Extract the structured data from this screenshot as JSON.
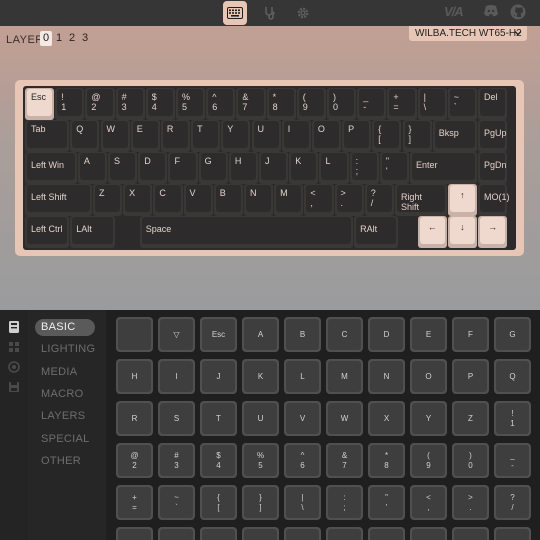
{
  "topbar": {
    "via_logo": "V/A"
  },
  "layer": {
    "label": "LAYER",
    "options": [
      "0",
      "1",
      "2",
      "3"
    ],
    "active": "0"
  },
  "device": {
    "name": "WILBA.TECH WT65-H2"
  },
  "keyboard": {
    "rows": [
      [
        {
          "l1": "Esc",
          "light": true
        },
        {
          "l1": "!",
          "l2": "1"
        },
        {
          "l1": "@",
          "l2": "2"
        },
        {
          "l1": "#",
          "l2": "3"
        },
        {
          "l1": "$",
          "l2": "4"
        },
        {
          "l1": "%",
          "l2": "5"
        },
        {
          "l1": "^",
          "l2": "6"
        },
        {
          "l1": "&",
          "l2": "7"
        },
        {
          "l1": "*",
          "l2": "8"
        },
        {
          "l1": "(",
          "l2": "9"
        },
        {
          "l1": ")",
          "l2": "0"
        },
        {
          "l1": "_",
          "l2": "-"
        },
        {
          "l1": "+",
          "l2": "="
        },
        {
          "l1": "|",
          "l2": "\\"
        },
        {
          "l1": "~",
          "l2": "`"
        },
        {
          "l1": "Del"
        }
      ],
      [
        {
          "l1": "Tab"
        },
        {
          "l1": "Q",
          "big": true
        },
        {
          "l1": "W",
          "big": true
        },
        {
          "l1": "E",
          "big": true
        },
        {
          "l1": "R",
          "big": true
        },
        {
          "l1": "T",
          "big": true
        },
        {
          "l1": "Y",
          "big": true
        },
        {
          "l1": "U",
          "big": true
        },
        {
          "l1": "I",
          "big": true
        },
        {
          "l1": "O",
          "big": true
        },
        {
          "l1": "P",
          "big": true
        },
        {
          "l1": "{",
          "l2": "["
        },
        {
          "l1": "}",
          "l2": "]"
        },
        {
          "l1": "Bksp",
          "mid": true
        },
        {
          "l1": "PgUp",
          "mid": true
        }
      ],
      [
        {
          "l1": "Left Win",
          "mid": true
        },
        {
          "l1": "A",
          "big": true
        },
        {
          "l1": "S",
          "big": true
        },
        {
          "l1": "D",
          "big": true
        },
        {
          "l1": "F",
          "big": true
        },
        {
          "l1": "G",
          "big": true
        },
        {
          "l1": "H",
          "big": true
        },
        {
          "l1": "J",
          "big": true
        },
        {
          "l1": "K",
          "big": true
        },
        {
          "l1": "L",
          "big": true
        },
        {
          "l1": ":",
          "l2": ";"
        },
        {
          "l1": "\"",
          "l2": "'"
        },
        {
          "l1": "Enter",
          "mid": true
        },
        {
          "l1": "PgDn",
          "mid": true
        }
      ],
      [
        {
          "l1": "Left Shift",
          "mid": true
        },
        {
          "l1": "Z",
          "big": true
        },
        {
          "l1": "X",
          "big": true
        },
        {
          "l1": "C",
          "big": true
        },
        {
          "l1": "V",
          "big": true
        },
        {
          "l1": "B",
          "big": true
        },
        {
          "l1": "N",
          "big": true
        },
        {
          "l1": "M",
          "big": true
        },
        {
          "l1": "<",
          "l2": ","
        },
        {
          "l1": ">",
          "l2": "."
        },
        {
          "l1": "?",
          "l2": "/"
        },
        {
          "l1": "Right Shift",
          "mid": true
        },
        {
          "l1": "↑",
          "light": true,
          "arrow": true
        },
        {
          "l1": "MO(1)",
          "mid": true
        }
      ],
      [
        {
          "l1": "Left Ctrl",
          "mid": true
        },
        {
          "l1": "LAlt",
          "mid": true
        },
        {
          "l1": "Space",
          "mid": true
        },
        {
          "l1": "RAlt",
          "mid": true
        },
        {
          "l1": "←",
          "light": true,
          "arrow": true
        },
        {
          "l1": "↓",
          "light": true,
          "arrow": true
        },
        {
          "l1": "→",
          "light": true,
          "arrow": true
        }
      ]
    ]
  },
  "categories": {
    "items": [
      "BASIC",
      "LIGHTING",
      "MEDIA",
      "MACRO",
      "LAYERS",
      "SPECIAL",
      "OTHER"
    ],
    "active": "BASIC"
  },
  "keycodes": {
    "rows": [
      [
        [
          ""
        ],
        [
          "▽"
        ],
        [
          "Esc"
        ],
        [
          "A"
        ],
        [
          "B"
        ],
        [
          "C"
        ],
        [
          "D"
        ],
        [
          "E"
        ],
        [
          "F"
        ],
        [
          "G"
        ]
      ],
      [
        [
          "H"
        ],
        [
          "I"
        ],
        [
          "J"
        ],
        [
          "K"
        ],
        [
          "L"
        ],
        [
          "M"
        ],
        [
          "N"
        ],
        [
          "O"
        ],
        [
          "P"
        ],
        [
          "Q"
        ]
      ],
      [
        [
          "R"
        ],
        [
          "S"
        ],
        [
          "T"
        ],
        [
          "U"
        ],
        [
          "V"
        ],
        [
          "W"
        ],
        [
          "X"
        ],
        [
          "Y"
        ],
        [
          "Z"
        ],
        [
          "!",
          "1"
        ]
      ],
      [
        [
          "@",
          "2"
        ],
        [
          "#",
          "3"
        ],
        [
          "$",
          "4"
        ],
        [
          "%",
          "5"
        ],
        [
          "^",
          "6"
        ],
        [
          "&",
          "7"
        ],
        [
          "*",
          "8"
        ],
        [
          "(",
          "9"
        ],
        [
          ")",
          "0"
        ],
        [
          "_",
          "-"
        ]
      ],
      [
        [
          "+",
          "="
        ],
        [
          "~",
          "`"
        ],
        [
          "{",
          "["
        ],
        [
          "}",
          "]"
        ],
        [
          "|",
          "\\"
        ],
        [
          ":",
          ";"
        ],
        [
          "\"",
          "'"
        ],
        [
          "<",
          ","
        ],
        [
          ">",
          "."
        ],
        [
          "?",
          "/"
        ]
      ],
      [
        [
          ""
        ],
        [
          ""
        ],
        [
          ""
        ],
        [
          ""
        ],
        [
          ""
        ],
        [
          ""
        ],
        [
          ""
        ],
        [
          ""
        ],
        [
          ""
        ],
        [
          ""
        ]
      ]
    ]
  },
  "colors": {
    "accent": "#e8c6b6",
    "keycap_dark": "#2d2b2b",
    "keycap_light": "#efd8cd"
  }
}
